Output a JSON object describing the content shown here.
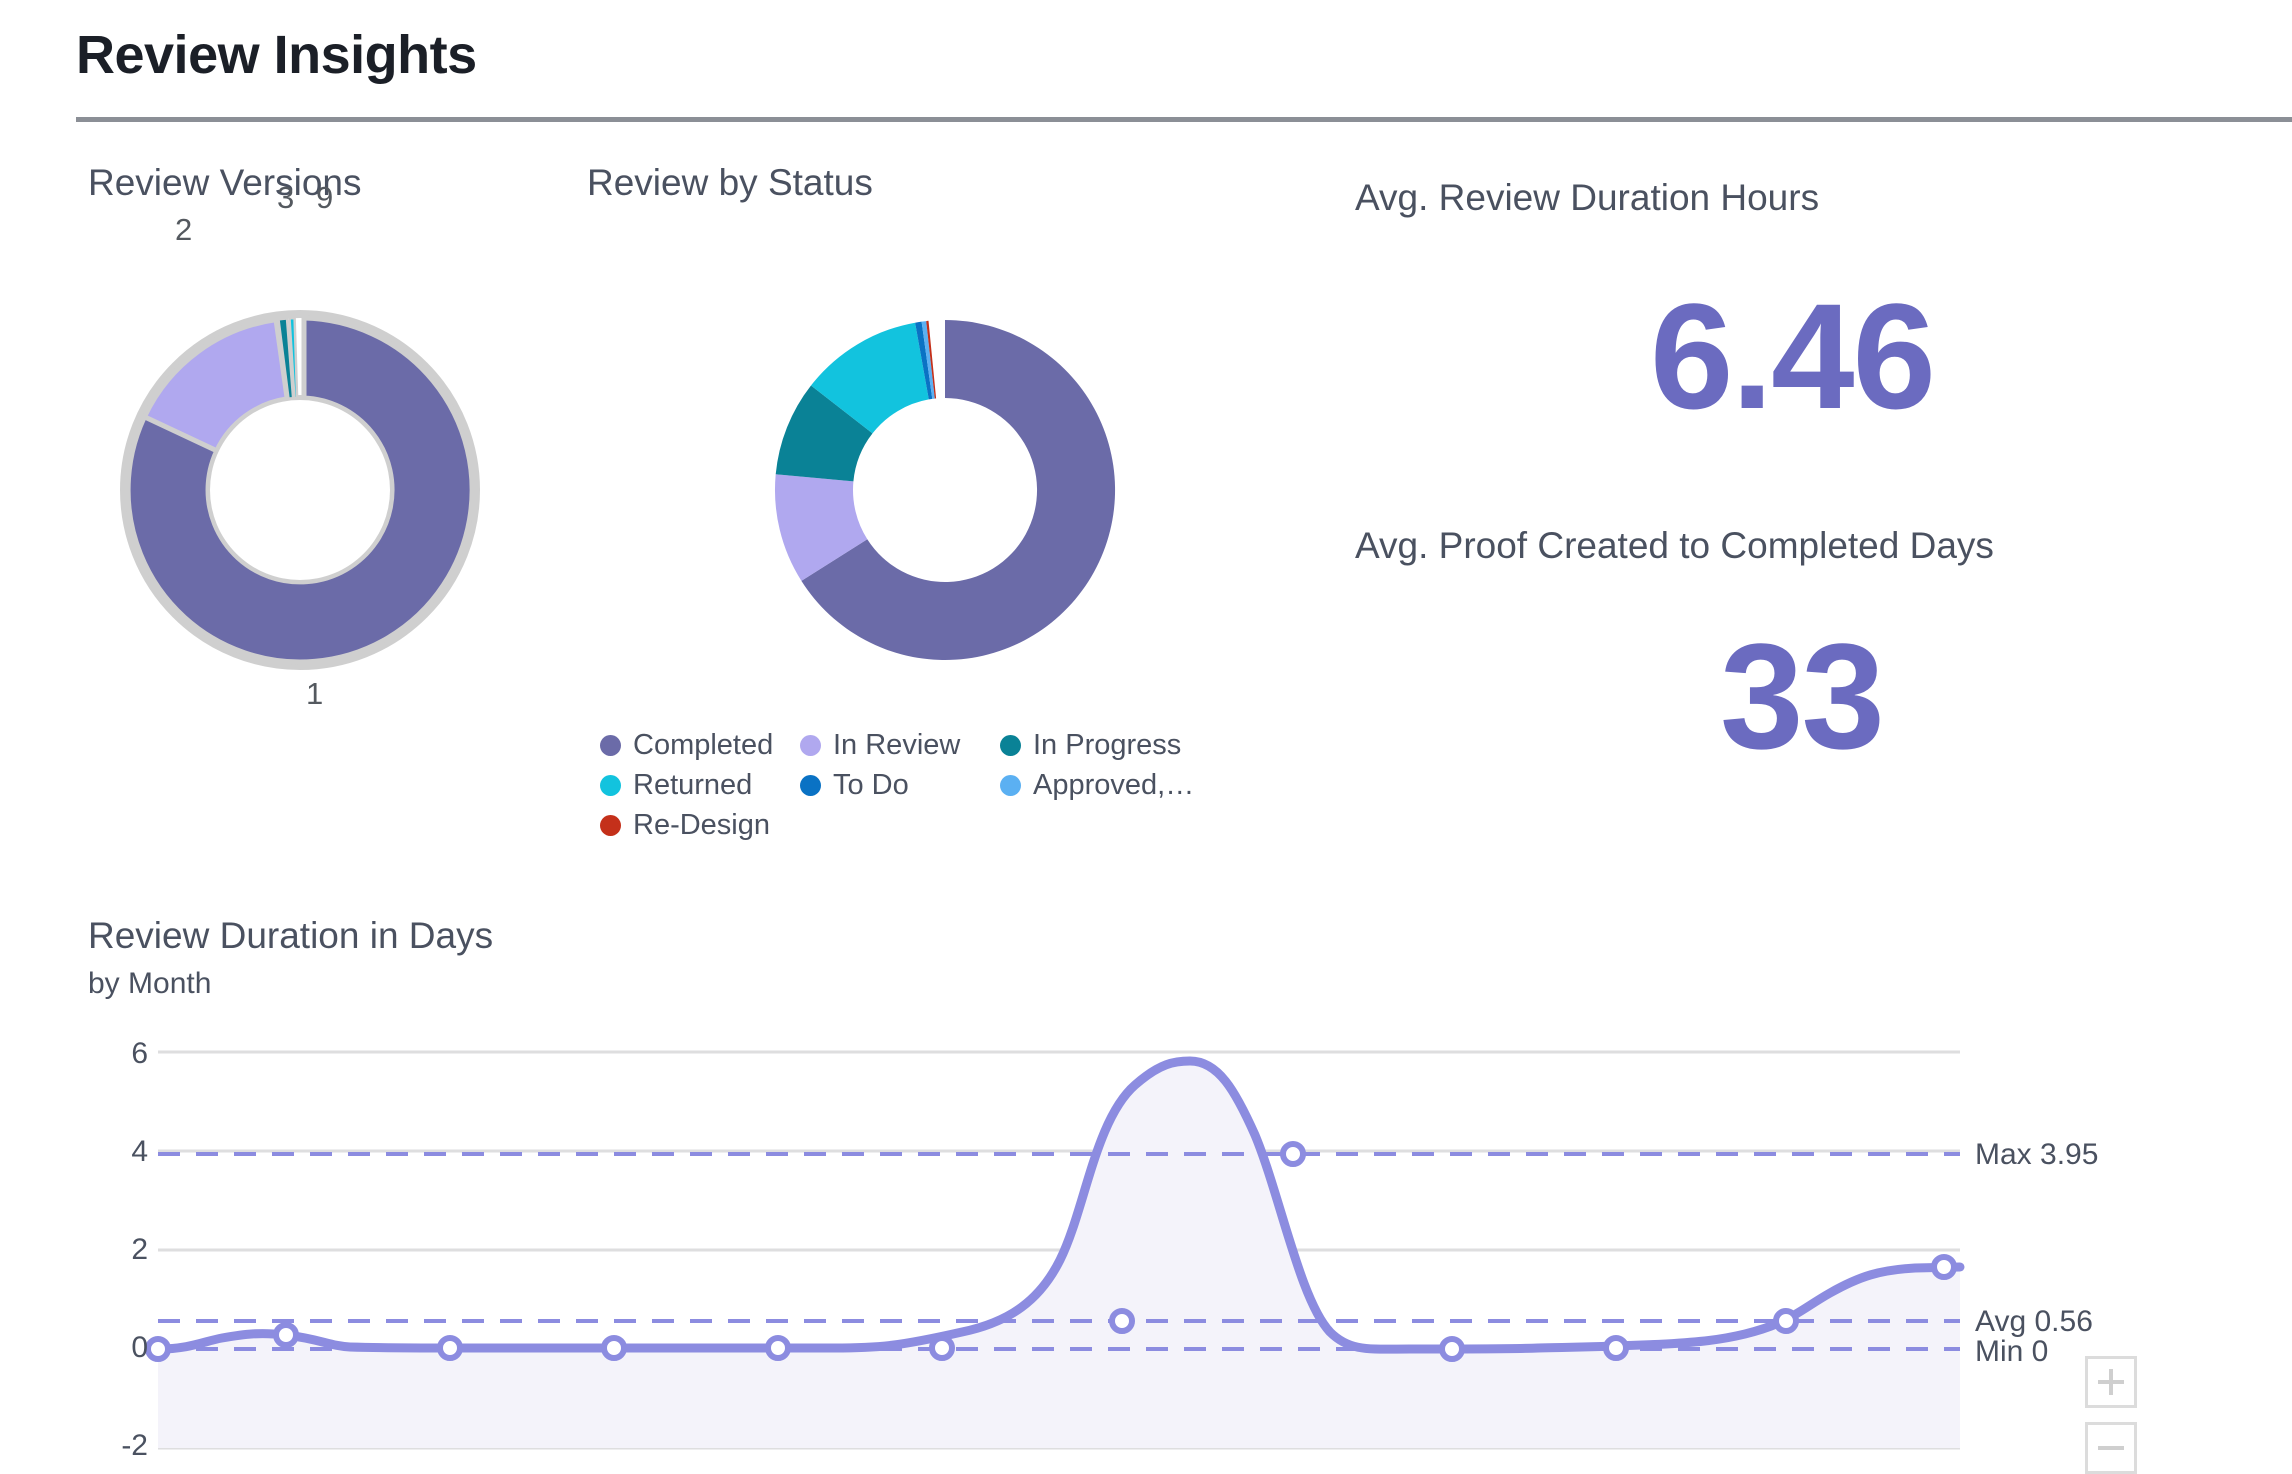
{
  "header": {
    "title": "Review Insights"
  },
  "panels": {
    "review_versions": {
      "title": "Review Versions"
    },
    "review_by_status": {
      "title": "Review by Status"
    },
    "review_duration": {
      "title": "Review Duration in Days",
      "subtitle": "by Month"
    }
  },
  "kpis": [
    {
      "label": "Avg. Review Duration Hours",
      "value": "6.46"
    },
    {
      "label": "Avg. Proof Created to Completed Days",
      "value": "33"
    }
  ],
  "legend": {
    "items": [
      {
        "label": "Completed",
        "color": "#6b6ba8"
      },
      {
        "label": "In Review",
        "color": "#b0a8ef"
      },
      {
        "label": "In Progress",
        "color": "#0a8296"
      },
      {
        "label": "Returned",
        "color": "#12c3de"
      },
      {
        "label": "To Do",
        "color": "#0a72c4"
      },
      {
        "label": "Approved,…",
        "color": "#5bb0f2"
      },
      {
        "label": "Re-Design",
        "color": "#c4301a"
      }
    ]
  },
  "zoom_controls": {
    "zoom_in_label": "+",
    "zoom_out_label": "−"
  },
  "chart_data": [
    {
      "type": "pie",
      "title": "Review Versions",
      "donut": true,
      "labels": [
        "1",
        "2",
        "3",
        "9"
      ],
      "values": [
        70.5,
        27.0,
        1.6,
        0.9
      ],
      "colors": [
        "#6b6ba8",
        "#b0a8ef",
        "#0a8296",
        "#12c3de"
      ],
      "label_positions": [
        "bottom",
        "upper-left",
        "top",
        "top-right"
      ],
      "legend": "none"
    },
    {
      "type": "pie",
      "title": "Review by Status",
      "donut": true,
      "categories": [
        "Completed",
        "In Review",
        "In Progress",
        "Returned",
        "To Do",
        "Approved,…",
        "Re-Design"
      ],
      "values": [
        69.0,
        12.0,
        10.0,
        8.0,
        0.6,
        0.3,
        0.1
      ],
      "colors": [
        "#6b6ba8",
        "#b0a8ef",
        "#0a8296",
        "#12c3de",
        "#0a72c4",
        "#5bb0f2",
        "#c4301a"
      ],
      "legend": "bottom"
    },
    {
      "type": "area",
      "title": "Review Duration in Days",
      "subtitle": "by Month",
      "xlabel": "",
      "ylabel": "",
      "ylim": [
        -2,
        6
      ],
      "yticks": [
        6,
        4,
        2,
        0,
        -2
      ],
      "grid": true,
      "line_color": "#8c8ce0",
      "fill_color": "#f3f2fb",
      "x": [
        1,
        2,
        3,
        4,
        5,
        6,
        7,
        8,
        9,
        10,
        11,
        12
      ],
      "values": [
        0,
        0.18,
        0.02,
        0.01,
        0.01,
        0.01,
        0.33,
        3.95,
        0,
        0.02,
        0.35,
        1.62
      ],
      "reference_lines": [
        {
          "name": "Max",
          "label": "Max 3.95",
          "value": 3.95,
          "style": "dashed",
          "color": "#8c8ce0"
        },
        {
          "name": "Avg",
          "label": "Avg 0.56",
          "value": 0.56,
          "style": "dashed",
          "color": "#8c8ce0"
        },
        {
          "name": "Min",
          "label": "Min 0",
          "value": 0.0,
          "style": "dashed",
          "color": "#8c8ce0"
        }
      ]
    }
  ]
}
